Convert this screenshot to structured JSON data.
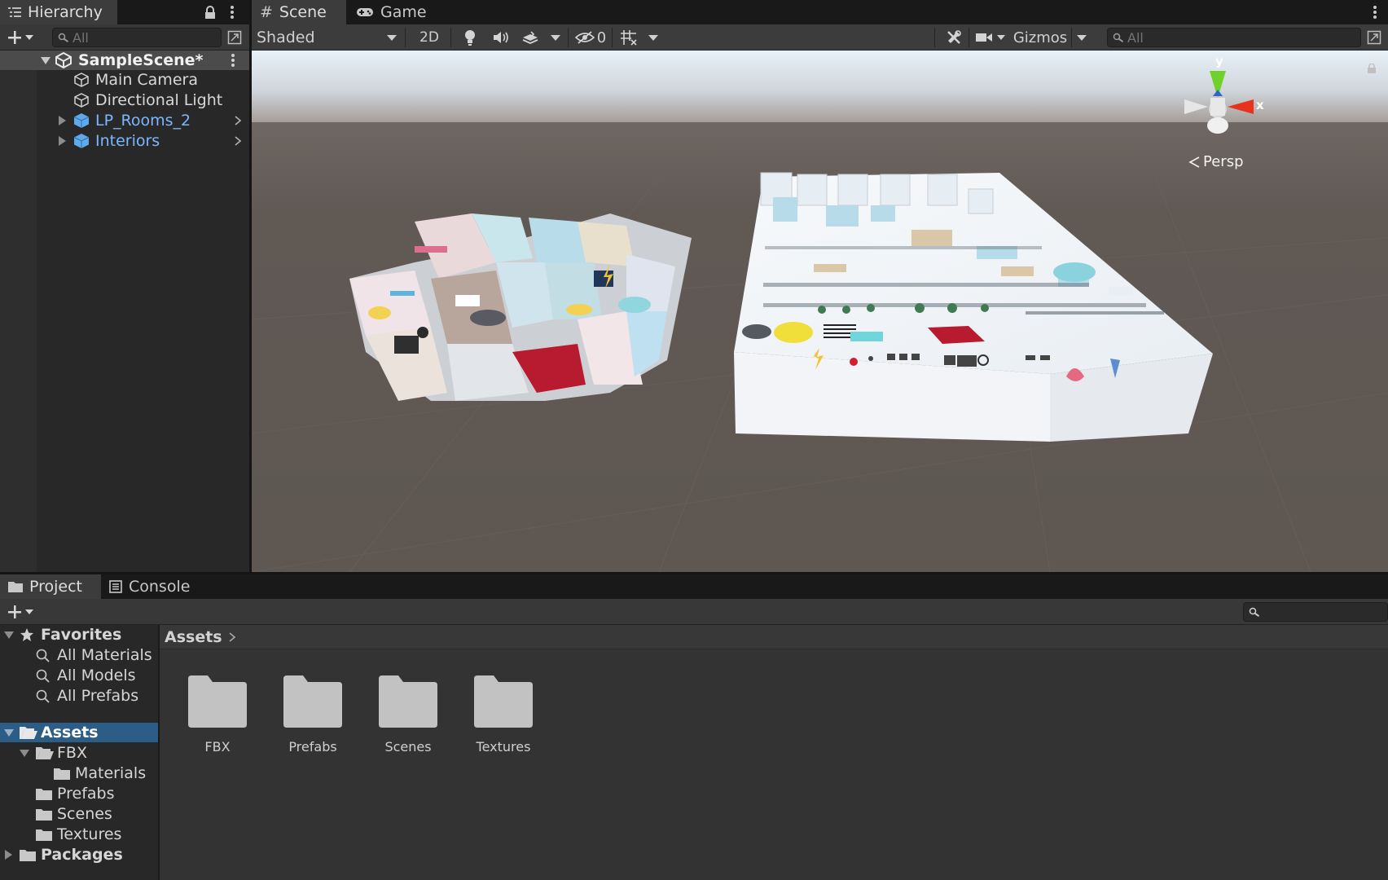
{
  "hierarchy": {
    "tab_label": "Hierarchy",
    "search_placeholder": "All",
    "scene_name": "SampleScene*",
    "items": [
      {
        "label": "Main Camera",
        "type": "gameobject"
      },
      {
        "label": "Directional Light",
        "type": "gameobject"
      },
      {
        "label": "LP_Rooms_2",
        "type": "prefab"
      },
      {
        "label": "Interiors",
        "type": "prefab"
      }
    ]
  },
  "tabs": {
    "scene": "Scene",
    "game": "Game"
  },
  "scene_toolbar": {
    "shading_mode": "Shaded",
    "mode_2d": "2D",
    "hidden_count": "0",
    "gizmos": "Gizmos",
    "search_placeholder": "All"
  },
  "viewport": {
    "projection_label": "Persp",
    "axis_y": "y",
    "axis_x": "x",
    "colors": {
      "y_axis": "#6fd12a",
      "x_axis": "#e8321e",
      "sky": "#cfd5db",
      "ground": "#605954"
    }
  },
  "bottom_tabs": {
    "project": "Project",
    "console": "Console"
  },
  "project": {
    "favorites": {
      "label": "Favorites",
      "items": [
        "All Materials",
        "All Models",
        "All Prefabs"
      ]
    },
    "tree": {
      "assets": "Assets",
      "fbx": "FBX",
      "materials": "Materials",
      "prefabs": "Prefabs",
      "scenes": "Scenes",
      "textures": "Textures",
      "packages": "Packages"
    },
    "breadcrumb": "Assets",
    "folders": [
      "FBX",
      "Prefabs",
      "Scenes",
      "Textures"
    ]
  }
}
